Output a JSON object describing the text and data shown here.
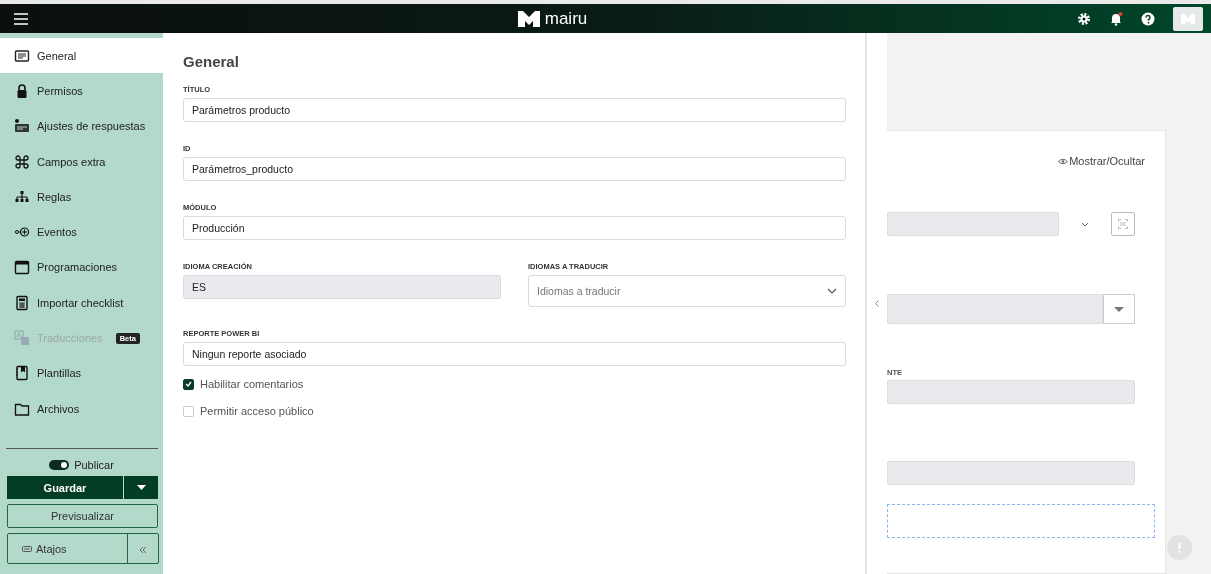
{
  "header": {
    "logo": "mairu",
    "notification": true
  },
  "sidebar": {
    "items": [
      {
        "label": "General",
        "selected": true,
        "disabled": false
      },
      {
        "label": "Permisos",
        "selected": false,
        "disabled": false
      },
      {
        "label": "Ajustes de respuestas",
        "selected": false,
        "disabled": false
      },
      {
        "label": "Campos extra",
        "selected": false,
        "disabled": false
      },
      {
        "label": "Reglas",
        "selected": false,
        "disabled": false
      },
      {
        "label": "Eventos",
        "selected": false,
        "disabled": false
      },
      {
        "label": "Programaciones",
        "selected": false,
        "disabled": false
      },
      {
        "label": "Importar checklist",
        "selected": false,
        "disabled": false
      },
      {
        "label": "Traducciones",
        "selected": false,
        "disabled": true,
        "badge": "Beta"
      },
      {
        "label": "Plantillas",
        "selected": false,
        "disabled": false
      },
      {
        "label": "Archivos",
        "selected": false,
        "disabled": false
      }
    ],
    "publish": {
      "label": "Publicar",
      "on": true
    },
    "save_button": "Guardar",
    "preview_button": "Previsualizar",
    "shortcuts_button": "Atajos"
  },
  "form": {
    "title": "General",
    "rows": [
      [
        {
          "label": "TÍTULO",
          "value": "Parámetros producto",
          "kind": "text"
        }
      ],
      [
        {
          "label": "ID",
          "value": "Parámetros_producto",
          "kind": "text"
        }
      ],
      [
        {
          "label": "MÓDULO",
          "value": "Producción",
          "kind": "text"
        }
      ],
      [
        {
          "label": "IDIOMA CREACIÓN",
          "value": "ES",
          "kind": "readonly"
        },
        {
          "label": "IDIOMAS A TRADUCIR",
          "placeholder": "Idiomas a traducir",
          "kind": "select"
        }
      ],
      [
        {
          "label": "REPORTE POWER BI",
          "value": "Ningun reporte asociado",
          "kind": "text"
        }
      ]
    ],
    "checkboxes": [
      {
        "label": "Habilitar comentarios",
        "checked": true
      },
      {
        "label": "Permitir acceso público",
        "checked": false
      }
    ]
  },
  "preview": {
    "toggle_link": "Mostrar/Ocultar",
    "field_label": "NTE"
  }
}
